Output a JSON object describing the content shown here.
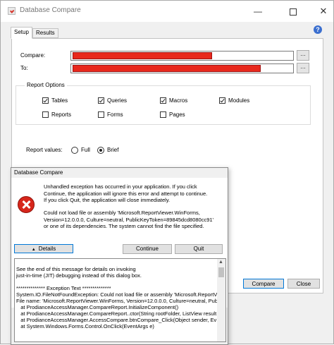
{
  "window": {
    "title": "Database Compare",
    "minimize_glyph": "—",
    "close_glyph": "✕"
  },
  "tabs": [
    "Setup",
    "Results"
  ],
  "help_glyph": "?",
  "form": {
    "compare_label": "Compare:",
    "to_label": "To:",
    "browse_label": "...",
    "redacted_color": "#e8281c"
  },
  "report_options": {
    "title": "Report Options",
    "items": [
      {
        "label": "Tables",
        "checked": true
      },
      {
        "label": "Queries",
        "checked": true
      },
      {
        "label": "Macros",
        "checked": true
      },
      {
        "label": "Modules",
        "checked": true
      },
      {
        "label": "Reports",
        "checked": false
      },
      {
        "label": "Forms",
        "checked": false
      },
      {
        "label": "Pages",
        "checked": false
      }
    ]
  },
  "report_values": {
    "label": "Report values:",
    "options": [
      {
        "label": "Full",
        "selected": false
      },
      {
        "label": "Brief",
        "selected": true
      }
    ]
  },
  "buttons": {
    "compare": "Compare",
    "close": "Close"
  },
  "dialog": {
    "title": "Database Compare",
    "message_lines": [
      "Unhandled exception has occurred in your application. If you click",
      "Continue, the application will ignore this error and attempt to continue.",
      "If you click Quit, the application will close immediately."
    ],
    "error_lines": [
      "Could not load file or assembly 'Microsoft.ReportViewer.WinForms,",
      "Version=12.0.0.0, Culture=neutral, PublicKeyToken=89845dcd8080cc91'",
      "or one of its dependencies. The system cannot find the file specified."
    ],
    "details_label": "Details",
    "continue_label": "Continue",
    "quit_label": "Quit",
    "details_lines": [
      "See the end of this message for details on invoking",
      "just-in-time (JIT) debugging instead of this dialog box.",
      "",
      "************** Exception Text **************",
      "System.IO.FileNotFoundException: Could not load file or assembly 'Microsoft.ReportVi",
      "File name: 'Microsoft.ReportViewer.WinForms, Version=12.0.0.0, Culture=neutral, Pub",
      "   at ProdianceAccessManager.CompareReport.InitializeComponent()",
      "   at ProdianceAccessManager.CompareReport..ctor(String rootFolder, ListView result",
      "   at ProdianceAccessManager.AccessCompare.btnCompare_Click(Object sender, Ev",
      "   at System.Windows.Forms.Control.OnClick(EventArgs e)"
    ]
  }
}
